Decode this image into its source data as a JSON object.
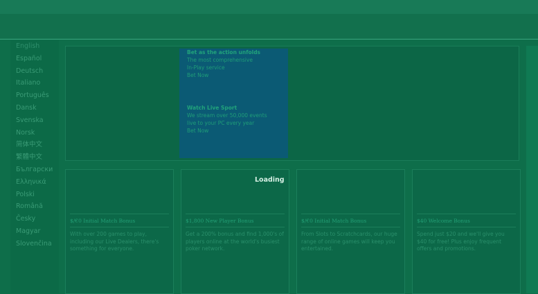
{
  "languages": [
    "English",
    "Español",
    "Deutsch",
    "Italiano",
    "Português",
    "Dansk",
    "Svenska",
    "Norsk",
    "简体中文",
    "繁體中文",
    "Български",
    "Ελληνικά",
    "Polski",
    "Română",
    "Česky",
    "Magyar",
    "Slovenčina"
  ],
  "promo": {
    "block1": {
      "title": "Bet as the action unfolds",
      "line1": "The most comprehensive",
      "line2": "In-Play service",
      "link": "Bet Now"
    },
    "block2": {
      "title": "Watch Live Sport",
      "line1": "We stream over 50,000 events",
      "line2": "live to your PC every year",
      "link": "Bet Now"
    }
  },
  "loading": "Loading",
  "cards": [
    {
      "title": "$/€0 Initial Match Bonus",
      "desc": "With over 200 games to play, including our Live Dealers, there's something for everyone."
    },
    {
      "title": "$1,800 New Player Bonus",
      "desc": "Get a 200% bonus and find 1,000's of players online at the world's busiest poker network."
    },
    {
      "title": "$/€0 Initial Match Bonus",
      "desc": "From Slots to Scratchcards, our huge range of online games will keep you entertained."
    },
    {
      "title": "$40 Welcome Bonus",
      "desc": "Spend just $20 and we'll give you $40 for free! Plus enjoy frequent offers and promotions."
    }
  ]
}
